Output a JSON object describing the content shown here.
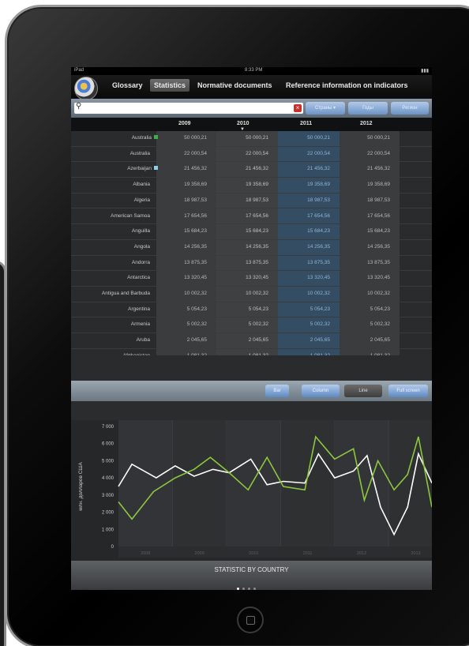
{
  "status_bar": {
    "carrier": "iPad",
    "time": "8:33 PM",
    "battery": ""
  },
  "nav": {
    "tabs": [
      "Glossary",
      "Statistics",
      "Normative documents",
      "Reference information on indicators"
    ],
    "active_tab": "Statistics"
  },
  "search": {
    "placeholder": "",
    "buttons": [
      "Страны",
      "Годы",
      "Регион"
    ]
  },
  "table": {
    "headers": [
      "2009",
      "2010",
      "2011",
      "2012"
    ],
    "rows": [
      {
        "country": "Australia",
        "marker": "#3fae49",
        "values": [
          "50 000,21",
          "50 000,21",
          "50 000,21",
          "50 000,21"
        ]
      },
      {
        "country": "Australia",
        "marker": "",
        "values": [
          "22 000,54",
          "22 000,54",
          "22 000,54",
          "22 000,54"
        ]
      },
      {
        "country": "Azerbaijan",
        "marker": "#8fcdf0",
        "values": [
          "21 456,32",
          "21 456,32",
          "21 456,32",
          "21 456,32"
        ]
      },
      {
        "country": "Albania",
        "marker": "",
        "values": [
          "19 358,69",
          "19 358,69",
          "19 358,69",
          "19 358,69"
        ]
      },
      {
        "country": "Algeria",
        "marker": "",
        "values": [
          "18 987,53",
          "18 987,53",
          "18 987,53",
          "18 987,53"
        ]
      },
      {
        "country": "American Samoa",
        "marker": "",
        "values": [
          "17 654,56",
          "17 654,56",
          "17 654,56",
          "17 654,56"
        ]
      },
      {
        "country": "Anguilla",
        "marker": "",
        "values": [
          "15 684,23",
          "15 684,23",
          "15 684,23",
          "15 684,23"
        ]
      },
      {
        "country": "Angola",
        "marker": "",
        "values": [
          "14 256,35",
          "14 256,35",
          "14 256,35",
          "14 256,35"
        ]
      },
      {
        "country": "Andorra",
        "marker": "",
        "values": [
          "13 875,35",
          "13 875,35",
          "13 875,35",
          "13 875,35"
        ]
      },
      {
        "country": "Antarctica",
        "marker": "",
        "values": [
          "13 320,45",
          "13 320,45",
          "13 320,45",
          "13 320,45"
        ]
      },
      {
        "country": "Antigua and Barbuda",
        "marker": "",
        "values": [
          "10 002,32",
          "10 002,32",
          "10 002,32",
          "10 002,32"
        ]
      },
      {
        "country": "Argentina",
        "marker": "",
        "values": [
          "5 054,23",
          "5 054,23",
          "5 054,23",
          "5 054,23"
        ]
      },
      {
        "country": "Armenia",
        "marker": "",
        "values": [
          "5 002,32",
          "5 002,32",
          "5 002,32",
          "5 002,32"
        ]
      },
      {
        "country": "Aruba",
        "marker": "",
        "values": [
          "2 045,65",
          "2 045,65",
          "2 045,65",
          "2 045,65"
        ]
      },
      {
        "country": "Afghanistan",
        "marker": "",
        "values": [
          "1 081,32",
          "1 081,32",
          "1 081,32",
          "1 081,32"
        ]
      }
    ]
  },
  "toolbar": {
    "buttons": [
      "Bar",
      "Column",
      "Line",
      "Full screen"
    ],
    "active": "Line"
  },
  "chart_data": {
    "type": "line",
    "title": "STATISTIC BY COUNTRY",
    "ylabel": "млн. долларов США",
    "xlabel": "",
    "ylim": [
      0,
      7000
    ],
    "y_ticks": [
      "0",
      "1 000",
      "2 000",
      "3 000",
      "4 000",
      "5 000",
      "6 000",
      "7 000"
    ],
    "x_ticks": [
      "2008",
      "2009",
      "2010",
      "2011",
      "2012",
      "2013"
    ],
    "xlim": [
      2007.5,
      2013.3
    ],
    "series": [
      {
        "color": "#ffffff",
        "x": [
          2007.5,
          2007.75,
          2008.2,
          2008.55,
          2008.9,
          2009.25,
          2009.55,
          2009.95,
          2010.25,
          2010.55,
          2010.95,
          2011.2,
          2011.5,
          2011.85,
          2012.1,
          2012.35,
          2012.6,
          2012.85,
          2013.05,
          2013.3
        ],
        "y": [
          3500,
          4800,
          4000,
          4700,
          4100,
          4500,
          4300,
          5100,
          3600,
          3800,
          3700,
          5400,
          4000,
          4400,
          5300,
          2300,
          700,
          2300,
          5400,
          3700
        ]
      },
      {
        "color": "#8cc63f",
        "x": [
          2007.5,
          2007.75,
          2008.15,
          2008.55,
          2008.9,
          2009.2,
          2009.55,
          2009.9,
          2010.25,
          2010.55,
          2010.95,
          2011.15,
          2011.5,
          2011.85,
          2012.05,
          2012.3,
          2012.6,
          2012.85,
          2013.05,
          2013.3
        ],
        "y": [
          2600,
          1600,
          3200,
          4000,
          4500,
          5200,
          4300,
          3300,
          5200,
          3500,
          3300,
          6400,
          5100,
          5700,
          2700,
          5000,
          3300,
          4200,
          6400,
          2300
        ]
      }
    ]
  },
  "footer": {
    "title": "STATISTIC BY COUNTRY",
    "page_dots": 4,
    "active_dot": 1
  }
}
